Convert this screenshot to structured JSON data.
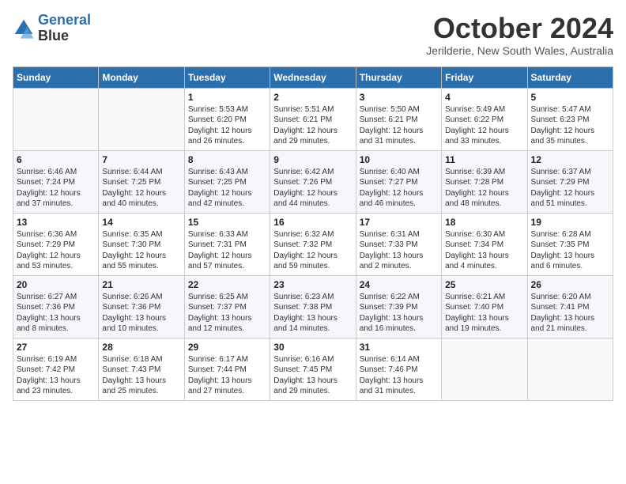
{
  "logo": {
    "line1": "General",
    "line2": "Blue"
  },
  "title": "October 2024",
  "subtitle": "Jerilderie, New South Wales, Australia",
  "days_header": [
    "Sunday",
    "Monday",
    "Tuesday",
    "Wednesday",
    "Thursday",
    "Friday",
    "Saturday"
  ],
  "weeks": [
    [
      {
        "day": "",
        "info": ""
      },
      {
        "day": "",
        "info": ""
      },
      {
        "day": "1",
        "info": "Sunrise: 5:53 AM\nSunset: 6:20 PM\nDaylight: 12 hours\nand 26 minutes."
      },
      {
        "day": "2",
        "info": "Sunrise: 5:51 AM\nSunset: 6:21 PM\nDaylight: 12 hours\nand 29 minutes."
      },
      {
        "day": "3",
        "info": "Sunrise: 5:50 AM\nSunset: 6:21 PM\nDaylight: 12 hours\nand 31 minutes."
      },
      {
        "day": "4",
        "info": "Sunrise: 5:49 AM\nSunset: 6:22 PM\nDaylight: 12 hours\nand 33 minutes."
      },
      {
        "day": "5",
        "info": "Sunrise: 5:47 AM\nSunset: 6:23 PM\nDaylight: 12 hours\nand 35 minutes."
      }
    ],
    [
      {
        "day": "6",
        "info": "Sunrise: 6:46 AM\nSunset: 7:24 PM\nDaylight: 12 hours\nand 37 minutes."
      },
      {
        "day": "7",
        "info": "Sunrise: 6:44 AM\nSunset: 7:25 PM\nDaylight: 12 hours\nand 40 minutes."
      },
      {
        "day": "8",
        "info": "Sunrise: 6:43 AM\nSunset: 7:25 PM\nDaylight: 12 hours\nand 42 minutes."
      },
      {
        "day": "9",
        "info": "Sunrise: 6:42 AM\nSunset: 7:26 PM\nDaylight: 12 hours\nand 44 minutes."
      },
      {
        "day": "10",
        "info": "Sunrise: 6:40 AM\nSunset: 7:27 PM\nDaylight: 12 hours\nand 46 minutes."
      },
      {
        "day": "11",
        "info": "Sunrise: 6:39 AM\nSunset: 7:28 PM\nDaylight: 12 hours\nand 48 minutes."
      },
      {
        "day": "12",
        "info": "Sunrise: 6:37 AM\nSunset: 7:29 PM\nDaylight: 12 hours\nand 51 minutes."
      }
    ],
    [
      {
        "day": "13",
        "info": "Sunrise: 6:36 AM\nSunset: 7:29 PM\nDaylight: 12 hours\nand 53 minutes."
      },
      {
        "day": "14",
        "info": "Sunrise: 6:35 AM\nSunset: 7:30 PM\nDaylight: 12 hours\nand 55 minutes."
      },
      {
        "day": "15",
        "info": "Sunrise: 6:33 AM\nSunset: 7:31 PM\nDaylight: 12 hours\nand 57 minutes."
      },
      {
        "day": "16",
        "info": "Sunrise: 6:32 AM\nSunset: 7:32 PM\nDaylight: 12 hours\nand 59 minutes."
      },
      {
        "day": "17",
        "info": "Sunrise: 6:31 AM\nSunset: 7:33 PM\nDaylight: 13 hours\nand 2 minutes."
      },
      {
        "day": "18",
        "info": "Sunrise: 6:30 AM\nSunset: 7:34 PM\nDaylight: 13 hours\nand 4 minutes."
      },
      {
        "day": "19",
        "info": "Sunrise: 6:28 AM\nSunset: 7:35 PM\nDaylight: 13 hours\nand 6 minutes."
      }
    ],
    [
      {
        "day": "20",
        "info": "Sunrise: 6:27 AM\nSunset: 7:36 PM\nDaylight: 13 hours\nand 8 minutes."
      },
      {
        "day": "21",
        "info": "Sunrise: 6:26 AM\nSunset: 7:36 PM\nDaylight: 13 hours\nand 10 minutes."
      },
      {
        "day": "22",
        "info": "Sunrise: 6:25 AM\nSunset: 7:37 PM\nDaylight: 13 hours\nand 12 minutes."
      },
      {
        "day": "23",
        "info": "Sunrise: 6:23 AM\nSunset: 7:38 PM\nDaylight: 13 hours\nand 14 minutes."
      },
      {
        "day": "24",
        "info": "Sunrise: 6:22 AM\nSunset: 7:39 PM\nDaylight: 13 hours\nand 16 minutes."
      },
      {
        "day": "25",
        "info": "Sunrise: 6:21 AM\nSunset: 7:40 PM\nDaylight: 13 hours\nand 19 minutes."
      },
      {
        "day": "26",
        "info": "Sunrise: 6:20 AM\nSunset: 7:41 PM\nDaylight: 13 hours\nand 21 minutes."
      }
    ],
    [
      {
        "day": "27",
        "info": "Sunrise: 6:19 AM\nSunset: 7:42 PM\nDaylight: 13 hours\nand 23 minutes."
      },
      {
        "day": "28",
        "info": "Sunrise: 6:18 AM\nSunset: 7:43 PM\nDaylight: 13 hours\nand 25 minutes."
      },
      {
        "day": "29",
        "info": "Sunrise: 6:17 AM\nSunset: 7:44 PM\nDaylight: 13 hours\nand 27 minutes."
      },
      {
        "day": "30",
        "info": "Sunrise: 6:16 AM\nSunset: 7:45 PM\nDaylight: 13 hours\nand 29 minutes."
      },
      {
        "day": "31",
        "info": "Sunrise: 6:14 AM\nSunset: 7:46 PM\nDaylight: 13 hours\nand 31 minutes."
      },
      {
        "day": "",
        "info": ""
      },
      {
        "day": "",
        "info": ""
      }
    ]
  ]
}
